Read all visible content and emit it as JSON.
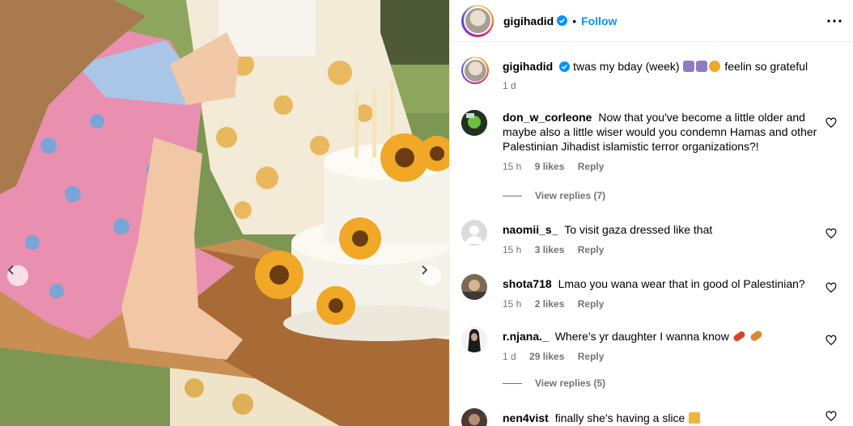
{
  "post": {
    "username": "gigihadid",
    "follow_label": "Follow",
    "separator": "•",
    "caption_text": "twas my bday (week)",
    "caption_end": "feelin so grateful",
    "caption_time": "1 d",
    "emojis": [
      "taurus-emoji",
      "taurus-emoji",
      "sunflower-emoji"
    ]
  },
  "comments": [
    {
      "username": "don_w_corleone",
      "text": "Now that you've become a little older and maybe also a little wiser would you condemn Hamas and other Palestinian Jihadist islamistic terror organizations?!",
      "time": "15 h",
      "likes": "9 likes",
      "reply": "Reply",
      "view_replies": "View replies (7)"
    },
    {
      "username": "naomii_s_",
      "text": "To visit gaza dressed like that",
      "time": "15 h",
      "likes": "3 likes",
      "reply": "Reply"
    },
    {
      "username": "shota718",
      "text": "Lmao you wana wear that in good ol Palestinian?",
      "time": "15 h",
      "likes": "2 likes",
      "reply": "Reply"
    },
    {
      "username": "r.njana._",
      "text": "Where's yr daughter I wanna know",
      "time": "1 d",
      "likes": "29 likes",
      "reply": "Reply",
      "view_replies": "View replies (5)",
      "emojis": [
        "firecracker-emoji",
        "candy-emoji"
      ]
    },
    {
      "username": "nen4vist",
      "text": "finally she's having a slice",
      "emojis": [
        "cake-slice-emoji"
      ]
    }
  ],
  "colors": {
    "accent": "#0095f6",
    "verified": "#0095f6",
    "muted": "#737373",
    "zodiac": "#8e7cc3"
  },
  "icons": [
    "verified-badge-icon",
    "more-options-icon",
    "heart-icon",
    "carousel-prev-icon",
    "carousel-next-icon"
  ]
}
